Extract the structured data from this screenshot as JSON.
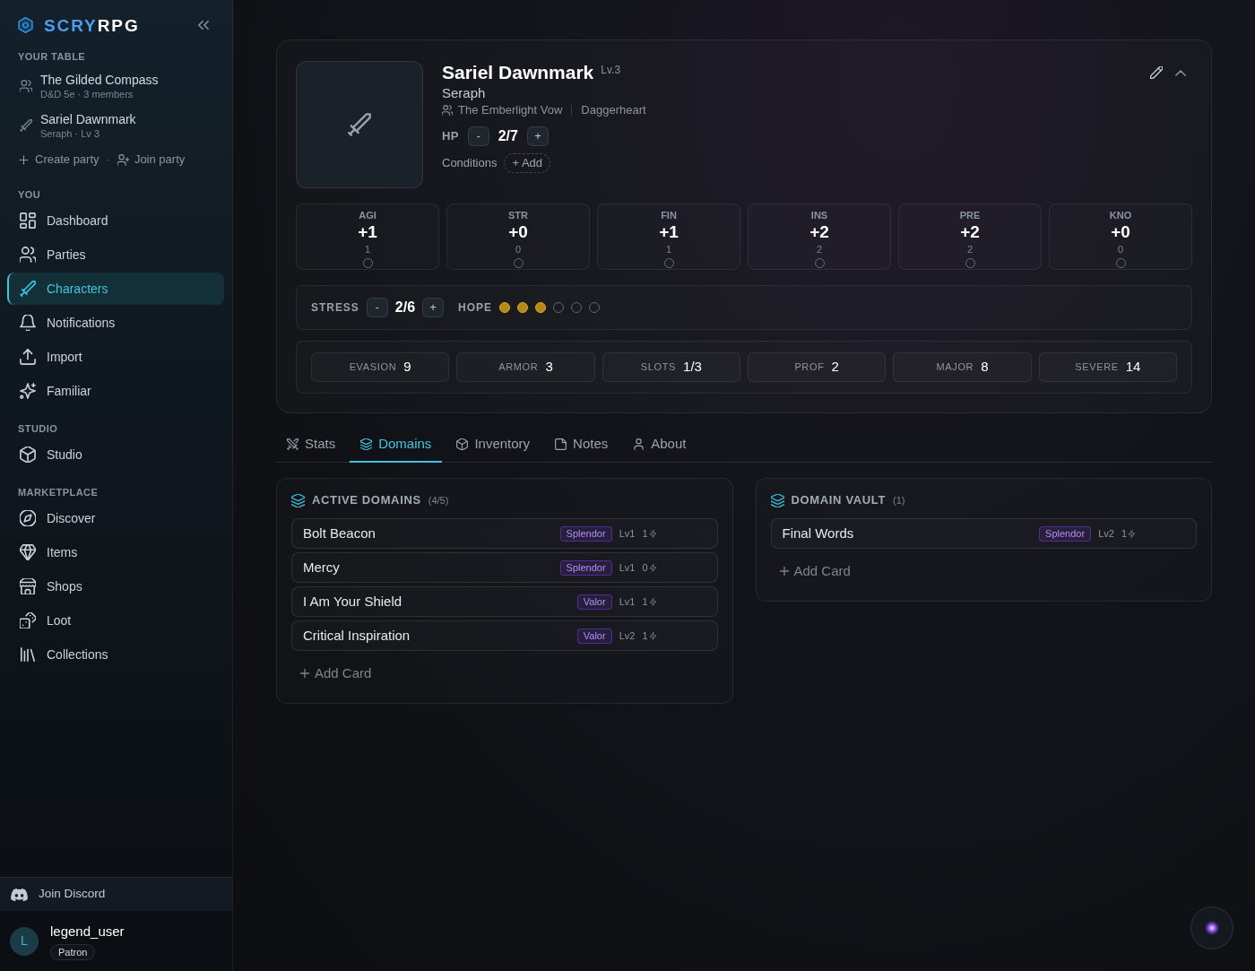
{
  "sidebar": {
    "brand": {
      "primary": "SCRY",
      "secondary": "RPG"
    },
    "table": {
      "heading": "YOUR TABLE",
      "items": [
        {
          "kind": "party",
          "title": "The Gilded Compass",
          "subtitle": "D&D 5e · 3 members"
        },
        {
          "kind": "character",
          "title": "Sariel Dawnmark",
          "subtitle": "Seraph · Lv 3"
        }
      ],
      "actions": [
        {
          "kind": "create",
          "label": "Create party"
        },
        {
          "kind": "join",
          "label": "Join party"
        }
      ],
      "separator": "·"
    },
    "sections": [
      {
        "heading": "YOU",
        "items": [
          {
            "kind": "dashboard",
            "label": "Dashboard",
            "selected": false
          },
          {
            "kind": "parties",
            "label": "Parties",
            "selected": false
          },
          {
            "kind": "characters",
            "label": "Characters",
            "selected": true
          },
          {
            "kind": "notifications",
            "label": "Notifications",
            "selected": false
          },
          {
            "kind": "import",
            "label": "Import",
            "selected": false
          },
          {
            "kind": "familiar",
            "label": "Familiar",
            "selected": false
          }
        ]
      },
      {
        "heading": "STUDIO",
        "items": [
          {
            "kind": "studio",
            "label": "Studio",
            "selected": false
          }
        ]
      },
      {
        "heading": "MARKETPLACE",
        "items": [
          {
            "kind": "discover",
            "label": "Discover",
            "selected": false
          },
          {
            "kind": "items",
            "label": "Items",
            "selected": false
          },
          {
            "kind": "shops",
            "label": "Shops",
            "selected": false
          },
          {
            "kind": "loot",
            "label": "Loot",
            "selected": false
          },
          {
            "kind": "collections",
            "label": "Collections",
            "selected": false
          }
        ]
      }
    ],
    "discord": {
      "label": "Join Discord"
    },
    "user": {
      "initial": "L",
      "name": "legend_user",
      "badge": "Patron"
    }
  },
  "character": {
    "name": "Sariel Dawnmark",
    "level": "Lv.3",
    "subtitle": "Seraph",
    "party": "The Emberlight Vow",
    "system": "Daggerheart",
    "hp": {
      "label": "HP",
      "decrement": "-",
      "value": "2/7",
      "increment": "+"
    },
    "conditions": {
      "label": "Conditions",
      "add": "+ Add"
    }
  },
  "traits": [
    {
      "label": "AGI",
      "modifier": "+1",
      "score": "1",
      "marked": false
    },
    {
      "label": "STR",
      "modifier": "+0",
      "score": "0",
      "marked": false
    },
    {
      "label": "FIN",
      "modifier": "+1",
      "score": "1",
      "marked": false
    },
    {
      "label": "INS",
      "modifier": "+2",
      "score": "2",
      "marked": false
    },
    {
      "label": "PRE",
      "modifier": "+2",
      "score": "2",
      "marked": false
    },
    {
      "label": "KNO",
      "modifier": "+0",
      "score": "0",
      "marked": false
    }
  ],
  "stress": {
    "label": "STRESS",
    "decrement": "-",
    "value": "2/6",
    "increment": "+"
  },
  "hope": {
    "label": "HOPE",
    "pips": [
      {
        "filled": true
      },
      {
        "filled": true
      },
      {
        "filled": true
      },
      {
        "filled": false
      },
      {
        "filled": false
      },
      {
        "filled": false
      }
    ]
  },
  "defenses": [
    {
      "label": "EVASION",
      "value": "9"
    },
    {
      "label": "ARMOR",
      "value": "3"
    },
    {
      "label": "SLOTS",
      "value": "1/3"
    },
    {
      "label": "PROF",
      "value": "2"
    },
    {
      "label": "MAJOR",
      "value": "8"
    },
    {
      "label": "SEVERE",
      "value": "14"
    }
  ],
  "tabs": [
    {
      "kind": "stats",
      "label": "Stats",
      "selected": false
    },
    {
      "kind": "domains",
      "label": "Domains",
      "selected": true
    },
    {
      "kind": "inventory",
      "label": "Inventory",
      "selected": false
    },
    {
      "kind": "notes",
      "label": "Notes",
      "selected": false
    },
    {
      "kind": "about",
      "label": "About",
      "selected": false
    }
  ],
  "panels": [
    {
      "title": "ACTIVE DOMAINS",
      "count": "(4/5)",
      "cards": [
        {
          "name": "Bolt Beacon",
          "domain": "Splendor",
          "level": "Lv1",
          "recall": "1"
        },
        {
          "name": "Mercy",
          "domain": "Splendor",
          "level": "Lv1",
          "recall": "0"
        },
        {
          "name": "I Am Your Shield",
          "domain": "Valor",
          "level": "Lv1",
          "recall": "1"
        },
        {
          "name": "Critical Inspiration",
          "domain": "Valor",
          "level": "Lv2",
          "recall": "1"
        }
      ],
      "add": "Add Card"
    },
    {
      "title": "DOMAIN VAULT",
      "count": "(1)",
      "cards": [
        {
          "name": "Final Words",
          "domain": "Splendor",
          "level": "Lv2",
          "recall": "1"
        }
      ],
      "add": "Add Card"
    }
  ]
}
